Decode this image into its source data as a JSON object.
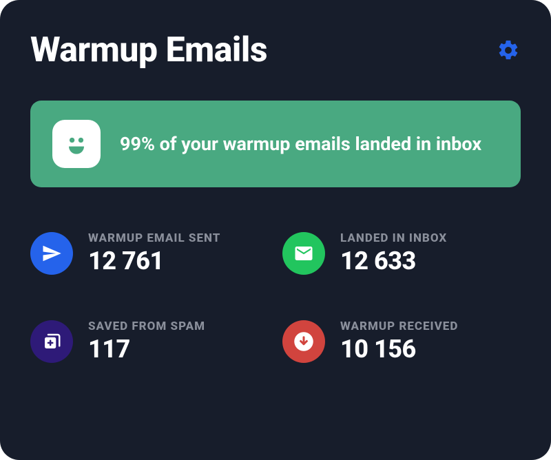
{
  "header": {
    "title": "Warmup Emails"
  },
  "banner": {
    "text": "99% of your warmup emails landed in inbox"
  },
  "stats": {
    "sent": {
      "label": "WARMUP EMAIL SENT",
      "value": "12 761"
    },
    "landed": {
      "label": "LANDED IN INBOX",
      "value": "12 633"
    },
    "saved": {
      "label": "SAVED FROM SPAM",
      "value": "117"
    },
    "received": {
      "label": "WARMUP RECEIVED",
      "value": "10 156"
    }
  }
}
